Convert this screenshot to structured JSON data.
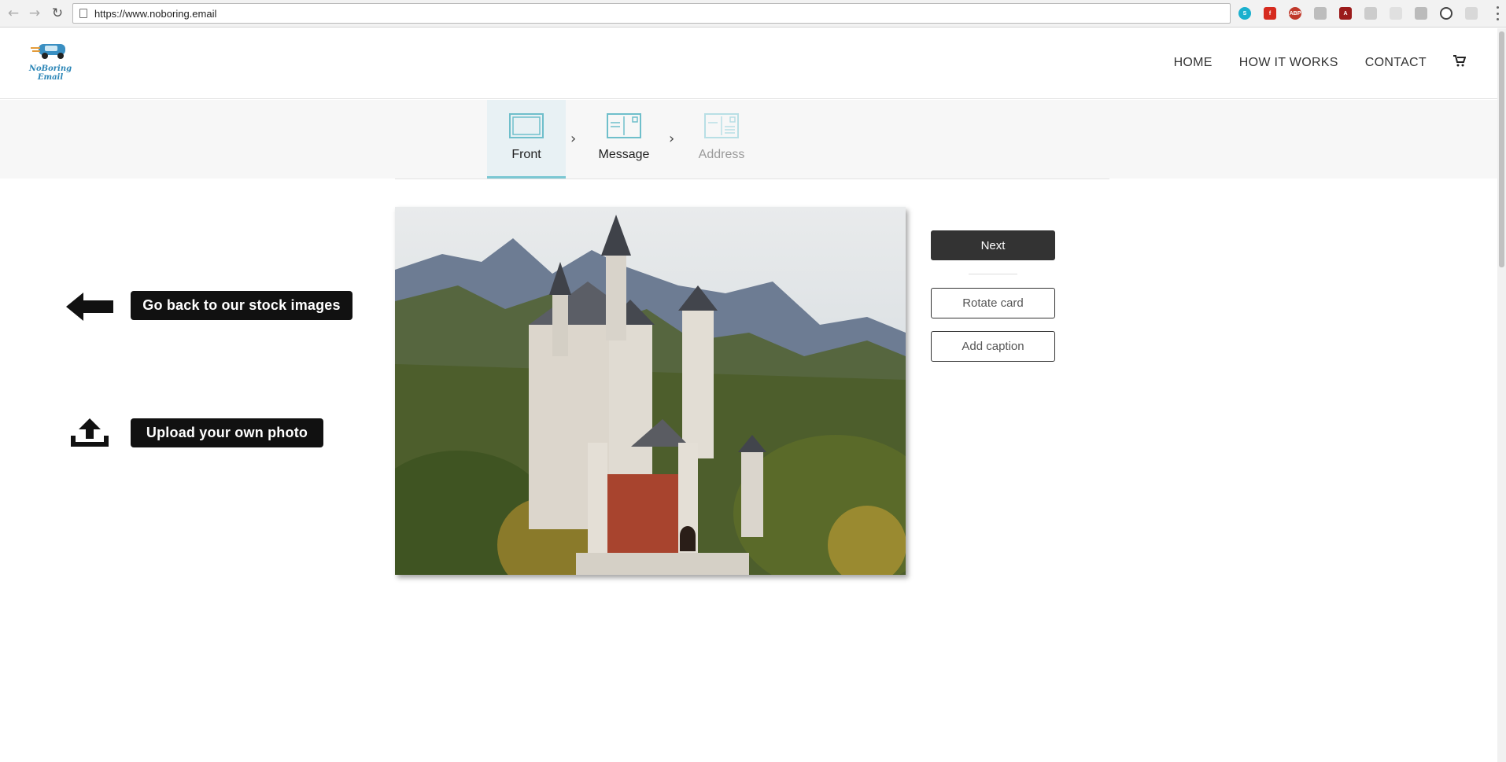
{
  "browser": {
    "url": "https://www.noboring.email",
    "extensions": [
      "shazam-icon",
      "flash-icon",
      "adblock-icon",
      "camera-icon",
      "pdf-icon",
      "script-icon",
      "feather-icon",
      "search-ext-icon",
      "block-icon",
      "chat-icon"
    ],
    "extension_labels": {
      "adblock": "ABP"
    }
  },
  "header": {
    "logo_line1": "NoBoring",
    "logo_line2": "Email",
    "nav": [
      "HOME",
      "HOW IT WORKS",
      "CONTACT"
    ],
    "cart_icon": "shopping-cart-icon"
  },
  "steps": [
    {
      "label": "Front",
      "state": "active"
    },
    {
      "label": "Message",
      "state": "normal"
    },
    {
      "label": "Address",
      "state": "disabled"
    }
  ],
  "actions": {
    "back_label": "Go back to our stock images",
    "upload_label": "Upload your own photo"
  },
  "card": {
    "next_label": "Next",
    "rotate_label": "Rotate card",
    "caption_label": "Add caption"
  },
  "colors": {
    "accent": "#7bc8d3",
    "dark_button": "#333333",
    "black_button": "#111111"
  }
}
